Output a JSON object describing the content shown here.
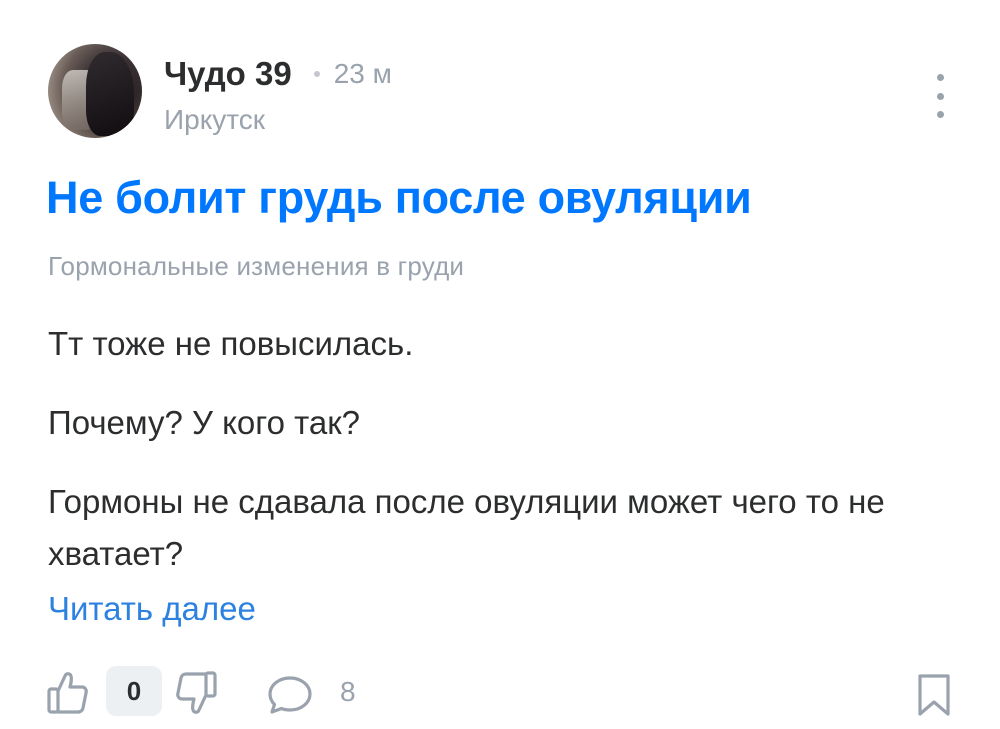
{
  "author": {
    "name": "Чудо 39",
    "time": "23 м",
    "location": "Иркутск"
  },
  "post": {
    "title": "Не болит грудь после овуляции",
    "topic": "Гормональные изменения в груди",
    "paragraphs": [
      "Тт тоже не повысилась.",
      "Почему? У кого так?",
      "Гормоны не сдавала после овуляции может чего то не хватает?"
    ],
    "read_more": "Читать далее"
  },
  "actions": {
    "rating": "0",
    "comments": "8"
  },
  "icons": {
    "like": "thumbs-up-icon",
    "dislike": "thumbs-down-icon",
    "comment": "comment-bubble-icon",
    "bookmark": "bookmark-icon",
    "more": "more-vertical-icon"
  },
  "colors": {
    "accent": "#0077ff",
    "link": "#2d81e0",
    "secondary_text": "#99a2ad",
    "primary_text": "#2c2d2e",
    "badge_bg": "#edf0f3"
  }
}
